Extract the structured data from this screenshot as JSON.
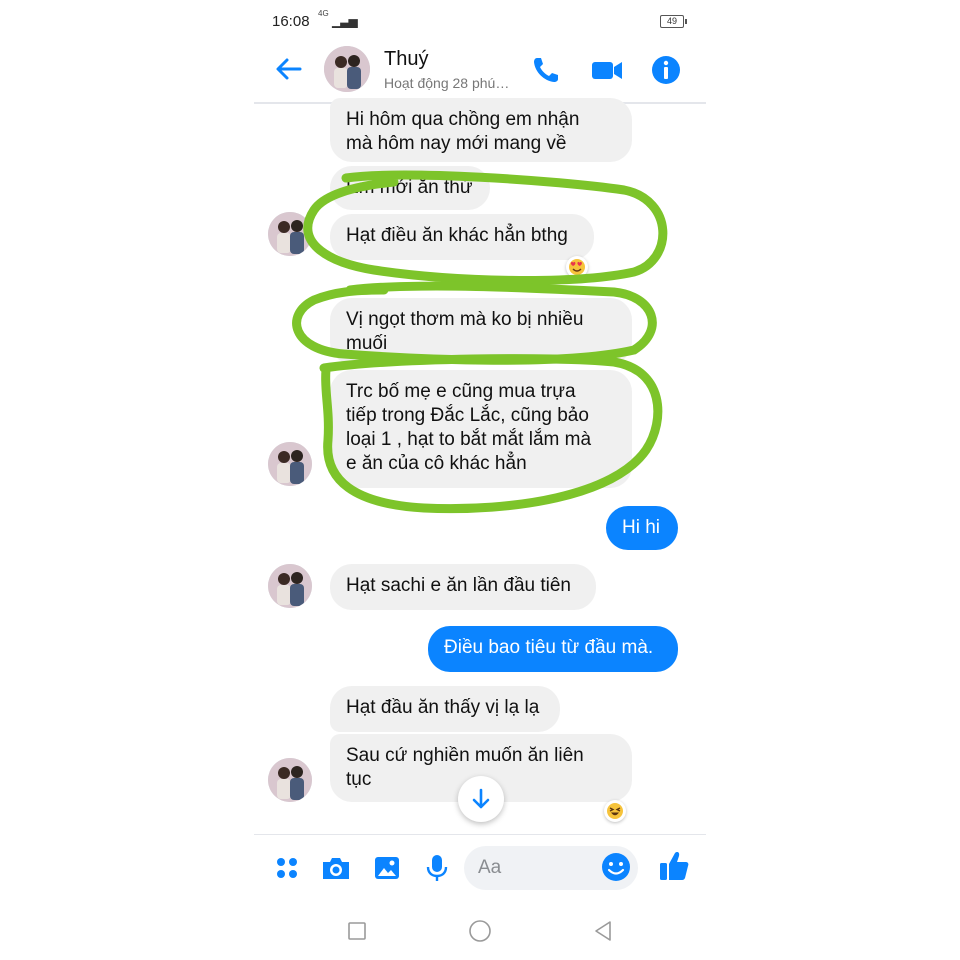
{
  "status_bar": {
    "time": "16:08",
    "network": "4G",
    "battery": "49"
  },
  "header": {
    "contact_name": "Thuý",
    "activity": "Hoạt động 28 phú…"
  },
  "messages": [
    {
      "sender": "them",
      "text_lines": [
        "Hi hôm qua chồng em nhận",
        "mà hôm nay mới mang về"
      ]
    },
    {
      "sender": "them",
      "text_lines": [
        "Em mới ăn thử"
      ]
    },
    {
      "sender": "them",
      "text_lines": [
        "Hạt điều ăn khác hẳn bthg"
      ],
      "reaction": "heart-eyes-emoji"
    },
    {
      "sender": "them",
      "text_lines": [
        "Vị ngọt thơm mà ko bị nhiều",
        "muối"
      ]
    },
    {
      "sender": "them",
      "text_lines": [
        "Trc bố mẹ e cũng mua trựa",
        "tiếp trong Đắc Lắc, cũng bảo",
        "loại 1 , hạt to bắt mắt lắm mà",
        "e ăn của cô khác hẳn"
      ]
    },
    {
      "sender": "me",
      "text_lines": [
        "Hi hi"
      ]
    },
    {
      "sender": "them",
      "text_lines": [
        "Hạt sachi e ăn lần đầu tiên"
      ]
    },
    {
      "sender": "me",
      "text_lines": [
        "Điều bao tiêu từ đầu mà."
      ]
    },
    {
      "sender": "them",
      "text_lines": [
        "Hạt đầu ăn thấy vị lạ lạ"
      ]
    },
    {
      "sender": "them",
      "text_lines": [
        "Sau cứ nghiền muốn ăn liên",
        "tục"
      ],
      "reaction": "laughing-emoji"
    }
  ],
  "composer": {
    "placeholder": "Aa"
  },
  "colors": {
    "accent": "#0b84ff",
    "bubble_them": "#f0f0f0",
    "highlight": "#7dc42a"
  }
}
